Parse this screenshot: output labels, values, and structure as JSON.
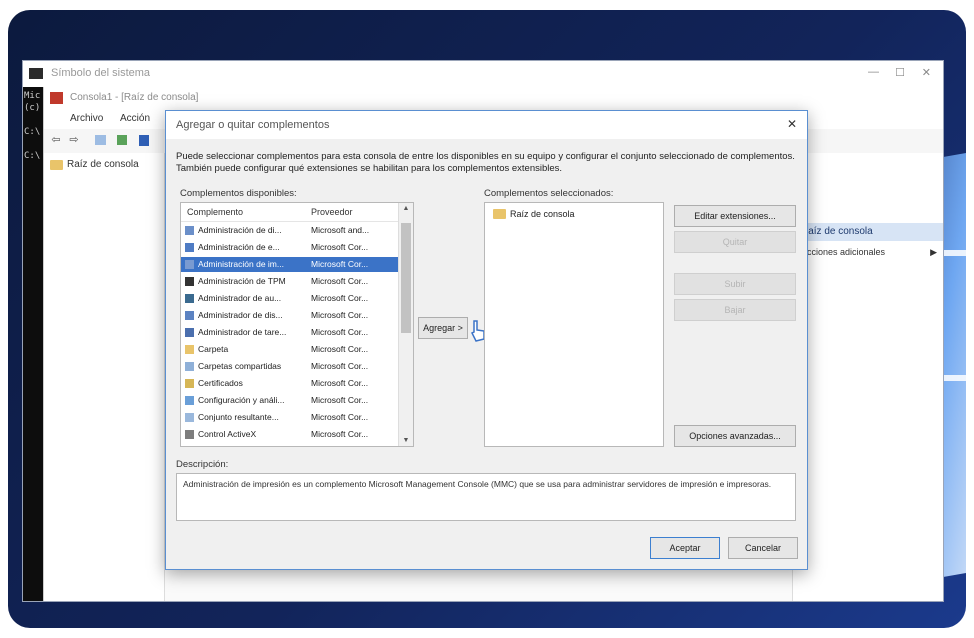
{
  "desktop_window": {
    "title": "Símbolo del sistema",
    "controls": {
      "minimize": "—",
      "maximize": "☐",
      "close": "✕"
    },
    "cmd_lines": [
      "Mic",
      "(c)",
      "C:\\",
      "C:\\"
    ]
  },
  "mmc": {
    "title": "Consola1 - [Raíz de consola]",
    "menu": [
      "Archivo",
      "Acción"
    ],
    "toolbar": [
      "⇦",
      "⇨"
    ],
    "tree_root": "Raíz de consola",
    "actions_header": "Raíz de consola",
    "actions_item": "Acciones adicionales",
    "actions_arrow": "▶"
  },
  "dialog": {
    "title": "Agregar o quitar complementos",
    "close": "✕",
    "description_top": "Puede seleccionar complementos para esta consola de entre los disponibles en su equipo y configurar el conjunto seleccionado de complementos. También puede configurar qué extensiones se habilitan para los complementos extensibles.",
    "available_label": "Complementos disponibles:",
    "selected_label": "Complementos seleccionados:",
    "columns": {
      "name": "Complemento",
      "vendor": "Proveedor"
    },
    "available": [
      {
        "name": "Administración de di...",
        "vendor": "Microsoft and...",
        "icon": "#6b8fc9",
        "selected": false
      },
      {
        "name": "Administración de e...",
        "vendor": "Microsoft Cor...",
        "icon": "#4f7cc4",
        "selected": false
      },
      {
        "name": "Administración de im...",
        "vendor": "Microsoft Cor...",
        "icon": "#7a9bd1",
        "selected": true
      },
      {
        "name": "Administración de TPM",
        "vendor": "Microsoft Cor...",
        "icon": "#333333",
        "selected": false
      },
      {
        "name": "Administrador de au...",
        "vendor": "Microsoft Cor...",
        "icon": "#3a6a8f",
        "selected": false
      },
      {
        "name": "Administrador de dis...",
        "vendor": "Microsoft Cor...",
        "icon": "#5c83c2",
        "selected": false
      },
      {
        "name": "Administrador de tare...",
        "vendor": "Microsoft Cor...",
        "icon": "#4b6fae",
        "selected": false
      },
      {
        "name": "Carpeta",
        "vendor": "Microsoft Cor...",
        "icon": "#e9c46a",
        "selected": false
      },
      {
        "name": "Carpetas compartidas",
        "vendor": "Microsoft Cor...",
        "icon": "#8fb0d8",
        "selected": false
      },
      {
        "name": "Certificados",
        "vendor": "Microsoft Cor...",
        "icon": "#d6b656",
        "selected": false
      },
      {
        "name": "Configuración y análi...",
        "vendor": "Microsoft Cor...",
        "icon": "#6a9fd8",
        "selected": false
      },
      {
        "name": "Conjunto resultante...",
        "vendor": "Microsoft Cor...",
        "icon": "#9ab8dc",
        "selected": false
      },
      {
        "name": "Control ActiveX",
        "vendor": "Microsoft Cor...",
        "icon": "#7d7d7d",
        "selected": false
      }
    ],
    "add_button": "Agregar >",
    "selected": [
      {
        "name": "Raíz de consola"
      }
    ],
    "buttons": {
      "edit_extensions": "Editar extensiones...",
      "remove": "Quitar",
      "move_up": "Subir",
      "move_down": "Bajar",
      "advanced": "Opciones avanzadas..."
    },
    "description_label": "Descripción:",
    "description_text": "Administración de impresión es un complemento Microsoft Management Console (MMC) que se usa para administrar servidores de impresión e impresoras.",
    "accept": "Aceptar",
    "cancel": "Cancelar"
  }
}
